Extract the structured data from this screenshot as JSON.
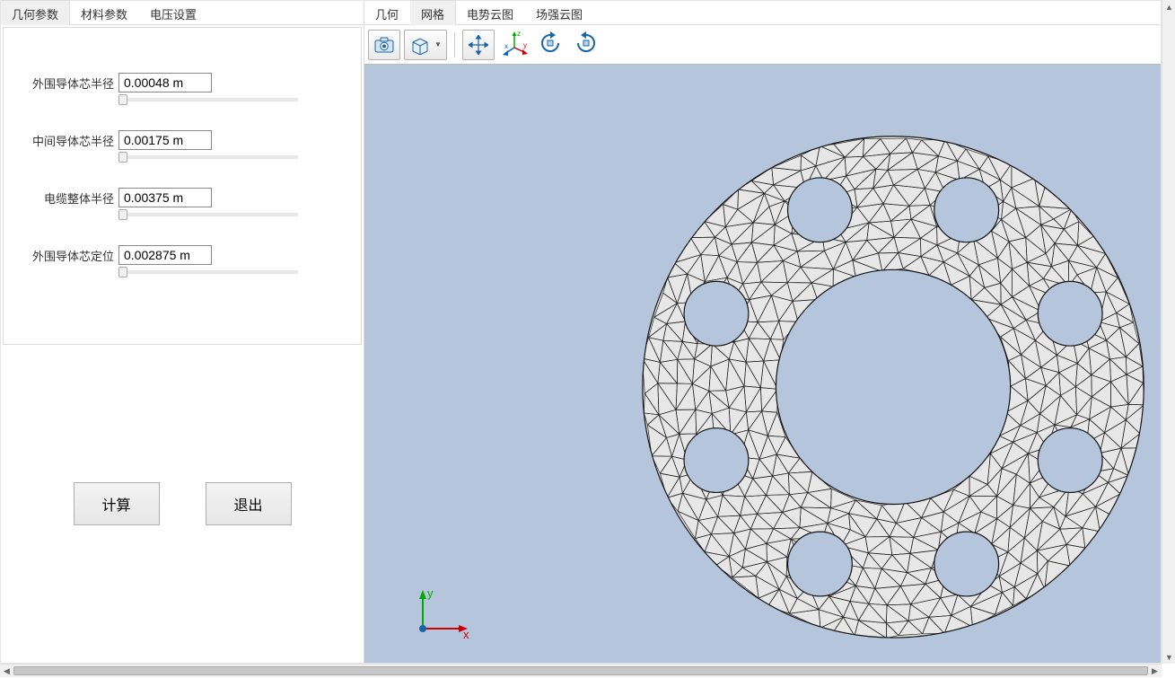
{
  "left_tabs": [
    {
      "label": "几何参数",
      "active": true
    },
    {
      "label": "材料参数",
      "active": false
    },
    {
      "label": "电压设置",
      "active": false
    }
  ],
  "params": [
    {
      "label": "外围导体芯半径",
      "value": "0.00048 m"
    },
    {
      "label": "中间导体芯半径",
      "value": "0.00175 m"
    },
    {
      "label": "电缆整体半径",
      "value": "0.00375 m"
    },
    {
      "label": "外围导体芯定位",
      "value": "0.002875 m"
    }
  ],
  "buttons": {
    "calc": "计算",
    "exit": "退出"
  },
  "right_tabs": [
    {
      "label": "几何",
      "active": false
    },
    {
      "label": "网格",
      "active": true
    },
    {
      "label": "电势云图",
      "active": false
    },
    {
      "label": "场强云图",
      "active": false
    }
  ],
  "axis": {
    "x": "x",
    "y": "y"
  },
  "toolbar_axis": {
    "x": "x",
    "y": "y",
    "z": "z"
  },
  "mesh": {
    "outer_radius": 280,
    "inner_radius": 131,
    "small_radius": 36,
    "small_center_r": 214,
    "n_small": 8
  }
}
